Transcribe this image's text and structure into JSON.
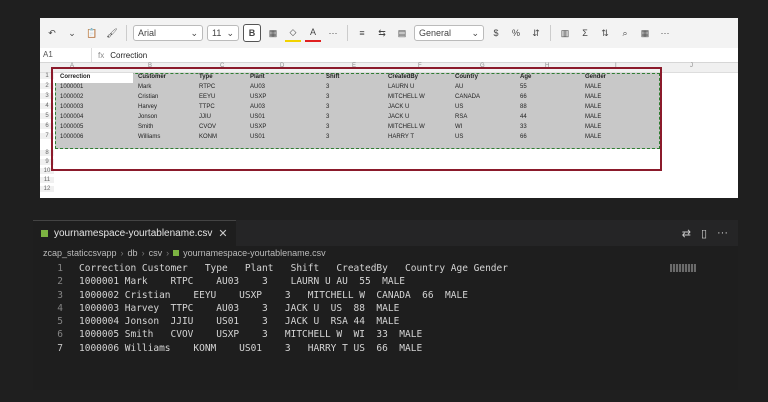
{
  "excel": {
    "ribbon": {
      "undo_icon": "undo-icon",
      "paste_icon": "clipboard-icon",
      "font_name": "Arial",
      "font_size": "11",
      "bold_label": "B",
      "more_label": "···",
      "number_format": "General",
      "currency_symbol": "$",
      "sum_symbol": "Σ"
    },
    "formula_bar": {
      "name_box": "A1",
      "fx_label": "fx",
      "value": "Correction"
    },
    "column_letters": [
      "A",
      "B",
      "C",
      "D",
      "E",
      "F",
      "G",
      "H",
      "I",
      "J"
    ],
    "row_numbers": [
      "1",
      "2",
      "3",
      "4",
      "5",
      "6",
      "7",
      "8",
      "9",
      "10",
      "11",
      "12"
    ],
    "headers": [
      "Correction",
      "Customer",
      "Type",
      "Plant",
      "Shift",
      "CreatedBy",
      "Country",
      "Age",
      "Gender"
    ],
    "rows": [
      [
        "1000001",
        "Mark",
        "RTPC",
        "AU03",
        "3",
        "LAURN U",
        "AU",
        "55",
        "MALE"
      ],
      [
        "1000002",
        "Cristian",
        "EEYU",
        "USXP",
        "3",
        "MITCHELL W",
        "CANADA",
        "66",
        "MALE"
      ],
      [
        "1000003",
        "Harvey",
        "TTPC",
        "AU03",
        "3",
        "JACK U",
        "US",
        "88",
        "MALE"
      ],
      [
        "1000004",
        "Jonson",
        "JJIU",
        "US01",
        "3",
        "JACK U",
        "RSA",
        "44",
        "MALE"
      ],
      [
        "1000005",
        "Smith",
        "CVOV",
        "USXP",
        "3",
        "MITCHELL W",
        "WI",
        "33",
        "MALE"
      ],
      [
        "1000006",
        "Williams",
        "KONM",
        "US01",
        "3",
        "HARRY T",
        "US",
        "66",
        "MALE"
      ]
    ]
  },
  "vscode": {
    "tab_label": "yournamespace-yourtablename.csv",
    "breadcrumb": [
      "zcap_staticcsvapp",
      "db",
      "csv",
      "yournamespace-yourtablename.csv"
    ],
    "lines": [
      {
        "num": "1",
        "text": "Correction Customer   Type   Plant   Shift   CreatedBy   Country Age Gender"
      },
      {
        "num": "2",
        "text": "1000001 Mark    RTPC    AU03    3    LAURN U AU  55  MALE"
      },
      {
        "num": "3",
        "text": "1000002 Cristian    EEYU    USXP    3   MITCHELL W  CANADA  66  MALE"
      },
      {
        "num": "4",
        "text": "1000003 Harvey  TTPC    AU03    3   JACK U  US  88  MALE"
      },
      {
        "num": "5",
        "text": "1000004 Jonson  JJIU    US01    3   JACK U  RSA 44  MALE"
      },
      {
        "num": "6",
        "text": "1000005 Smith   CVOV    USXP    3   MITCHELL W  WI  33  MALE"
      },
      {
        "num": "7",
        "text": "1000006 Williams    KONM    US01    3   HARRY T US  66  MALE"
      }
    ]
  },
  "colors": {
    "selection_outline": "#8b1a2b",
    "selection_fill": "#c8c8c8",
    "csv_icon": "#7cb342"
  }
}
